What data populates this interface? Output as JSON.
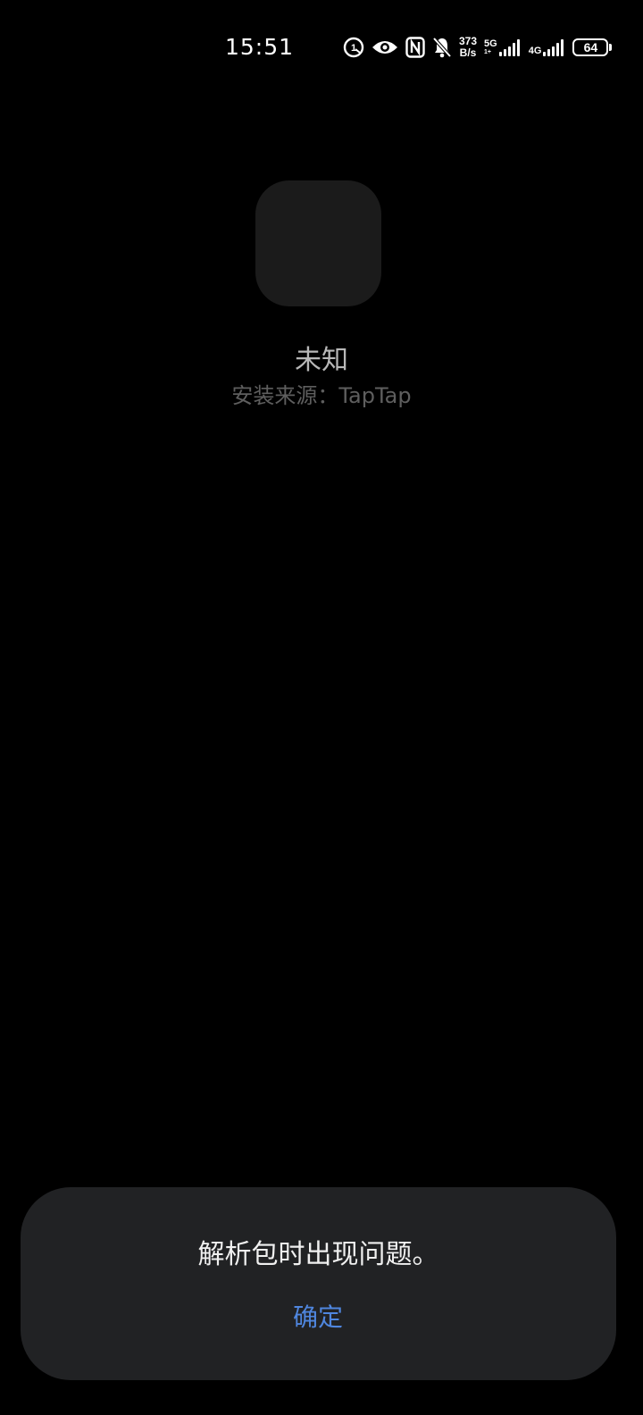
{
  "status_bar": {
    "time": "15:51",
    "icons": [
      "one-handed-mode-icon",
      "eye-comfort-icon",
      "nfc-icon",
      "notifications-off-icon"
    ],
    "net_speed_value": "373",
    "net_speed_unit": "B/s",
    "network_1": {
      "label": "5G",
      "sub": "1+",
      "bars": 5
    },
    "network_2": {
      "label": "4G",
      "sub": "",
      "bars": 5
    },
    "battery_level": "64"
  },
  "app": {
    "name": "未知",
    "source_label": "安装来源：TapTap"
  },
  "dialog": {
    "message": "解析包时出现问题。",
    "confirm_label": "确定"
  },
  "colors": {
    "background": "#000000",
    "dialog_background": "#212224",
    "icon_placeholder": "#1b1b1b",
    "accent": "#4f86de"
  }
}
